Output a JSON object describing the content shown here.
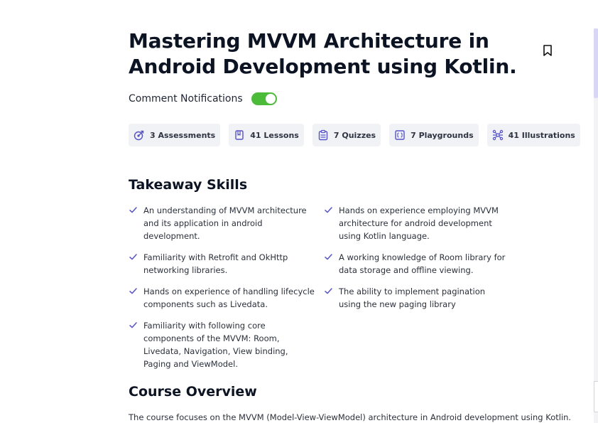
{
  "course": {
    "title": "Mastering MVVM Architecture in Android Development using Kotlin."
  },
  "notifications": {
    "label": "Comment Notifications",
    "enabled": true
  },
  "stats": [
    {
      "label": "3 Assessments",
      "icon": "assessment-icon"
    },
    {
      "label": "41 Lessons",
      "icon": "lesson-icon"
    },
    {
      "label": "7 Quizzes",
      "icon": "quiz-icon"
    },
    {
      "label": "7 Playgrounds",
      "icon": "playground-icon"
    },
    {
      "label": "41 Illustrations",
      "icon": "illustration-icon"
    }
  ],
  "takeaway": {
    "title": "Takeaway Skills",
    "skills": [
      "An understanding of MVVM architecture and its application in android development.",
      "Hands on experience employing MVVM architecture for android development using Kotlin language.",
      "Familiarity with Retrofit and OkHttp networking libraries.",
      "A working knowledge of Room library for data storage and offline viewing.",
      "Hands on experience of handling lifecycle components such as Livedata.",
      "The ability to implement pagination using the new paging library",
      "Familiarity with following core components of the MVVM: Room, Livedata, Navigation, View binding, Paging and ViewModel."
    ]
  },
  "overview": {
    "title": "Course Overview",
    "text": "The course focuses on the MVVM (Model-View-ViewModel) architecture in Android development using Kotlin."
  },
  "colors": {
    "accent": "#5553c6",
    "toggle_on": "#4dbb3a",
    "chip_bg": "#f1f2f6"
  }
}
